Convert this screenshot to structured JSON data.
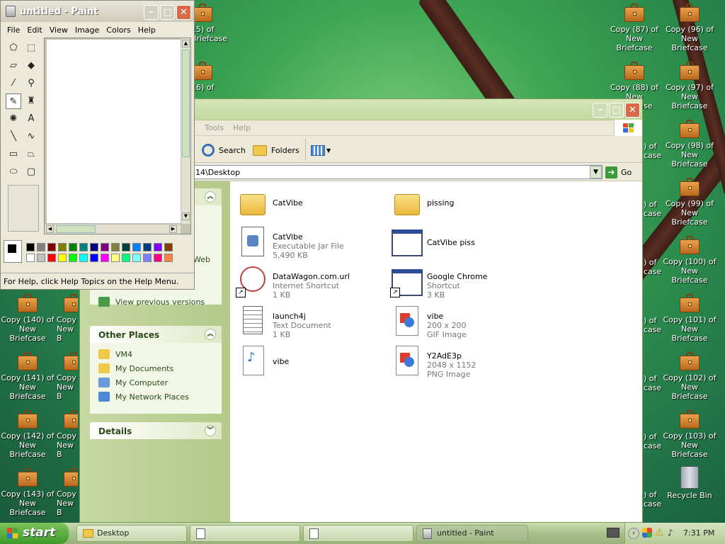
{
  "desktop": {
    "icons_right": [
      [
        "Copy (87) of",
        "New Briefcase"
      ],
      [
        "Copy (96) of",
        "New Briefcase"
      ],
      [
        "Copy (88) of",
        "New Briefcase"
      ],
      [
        "Copy (97) of",
        "New Briefcase"
      ],
      [
        "Copy (98) of",
        "New Briefcase"
      ],
      [
        "Copy (99) of",
        "New Briefcase"
      ],
      [
        "Copy (100) of",
        "New Briefcase"
      ],
      [
        "Copy (101) of",
        "New Briefcase"
      ],
      [
        "Copy (102) of",
        "New Briefcase"
      ],
      [
        "Copy (103) of",
        "New Briefcase"
      ]
    ],
    "icons_left": [
      [
        "Copy (140) of",
        "New Briefcase"
      ],
      [
        "Copy (141) of",
        "New Briefcase"
      ],
      [
        "Copy (142) of",
        "New Briefcase"
      ],
      [
        "Copy (143) of",
        "New Briefcase"
      ]
    ],
    "partial_left": [
      "Copy",
      "New B"
    ],
    "partial_top": [
      [
        "15) of",
        "Briefcase"
      ],
      [
        "16) of",
        "..."
      ]
    ],
    "partial_right": [
      ") of",
      "case"
    ],
    "recycle_bin": "Recycle Bin"
  },
  "explorer": {
    "menu": [
      "Tools",
      "Help"
    ],
    "toolbar": {
      "search": "Search",
      "folders": "Folders"
    },
    "address": "14\\Desktop",
    "go": "Go",
    "tasks_partial": {
      "web": "Web",
      "previous": "View previous versions"
    },
    "other_places": {
      "title": "Other Places",
      "items": [
        "VM4",
        "My Documents",
        "My Computer",
        "My Network Places"
      ]
    },
    "details": {
      "title": "Details"
    },
    "files": [
      {
        "name": "CatVibe",
        "sub1": "",
        "sub2": "",
        "icon": "folder-icon"
      },
      {
        "name": "pissing",
        "sub1": "",
        "sub2": "",
        "icon": "folder-icon"
      },
      {
        "name": "CatVibe",
        "sub1": "Executable Jar File",
        "sub2": "5,490 KB",
        "icon": "jar-icon"
      },
      {
        "name": "CatVibe piss",
        "sub1": "",
        "sub2": "",
        "icon": "window-icon"
      },
      {
        "name": "DataWagon.com.url",
        "sub1": "Internet Shortcut",
        "sub2": "1 KB",
        "icon": "url-icon"
      },
      {
        "name": "Google Chrome",
        "sub1": "Shortcut",
        "sub2": "3 KB",
        "icon": "window-icon"
      },
      {
        "name": "launch4j",
        "sub1": "Text Document",
        "sub2": "1 KB",
        "icon": "text-doc-icon"
      },
      {
        "name": "vibe",
        "sub1": "200 x 200",
        "sub2": "GIF Image",
        "icon": "image-icon"
      },
      {
        "name": "vibe",
        "sub1": "",
        "sub2": "",
        "icon": "mp3-icon"
      },
      {
        "name": "Y2AdE3p",
        "sub1": "2048 x 1152",
        "sub2": "PNG Image",
        "icon": "image-icon"
      }
    ]
  },
  "paint": {
    "title": "untitled - Paint",
    "menu": [
      "File",
      "Edit",
      "View",
      "Image",
      "Colors",
      "Help"
    ],
    "status": "For Help, click Help Topics on the Help Menu.",
    "palette_top": [
      "#000000",
      "#808080",
      "#800000",
      "#808000",
      "#008000",
      "#008080",
      "#000080",
      "#800080",
      "#808040",
      "#004040",
      "#0080ff",
      "#004080",
      "#8000ff",
      "#804000"
    ],
    "palette_bottom": [
      "#ffffff",
      "#c0c0c0",
      "#ff0000",
      "#ffff00",
      "#00ff00",
      "#00ffff",
      "#0000ff",
      "#ff00ff",
      "#ffff80",
      "#00ff80",
      "#80ffff",
      "#8080ff",
      "#ff0080",
      "#ff8040"
    ]
  },
  "taskbar": {
    "start": "start",
    "buttons": [
      {
        "label": "Desktop"
      },
      {
        "label": ""
      },
      {
        "label": ""
      },
      {
        "label": "untitled - Paint"
      }
    ],
    "clock": "7:31 PM"
  }
}
